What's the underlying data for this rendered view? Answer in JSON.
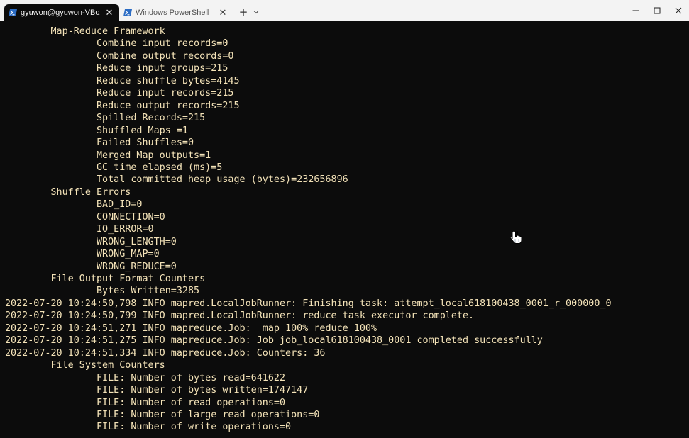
{
  "tabs": [
    {
      "label": "gyuwon@gyuwon-VBox: ~/v",
      "active": true,
      "icon": "powershell-icon"
    },
    {
      "label": "Windows PowerShell",
      "active": false,
      "icon": "powershell-icon"
    }
  ],
  "controls": {
    "new_tab": "+",
    "close_glyph": "✕"
  },
  "colors": {
    "terminal_bg": "#0c0c0c",
    "terminal_text": "#f4e3b8",
    "titlebar_bg": "#f3f3f3",
    "powershell_blue": "#2b6cc4"
  },
  "terminal": {
    "lines": [
      "        Map-Reduce Framework",
      "                Combine input records=0",
      "                Combine output records=0",
      "                Reduce input groups=215",
      "                Reduce shuffle bytes=4145",
      "                Reduce input records=215",
      "                Reduce output records=215",
      "                Spilled Records=215",
      "                Shuffled Maps =1",
      "                Failed Shuffles=0",
      "                Merged Map outputs=1",
      "                GC time elapsed (ms)=5",
      "                Total committed heap usage (bytes)=232656896",
      "        Shuffle Errors",
      "                BAD_ID=0",
      "                CONNECTION=0",
      "                IO_ERROR=0",
      "                WRONG_LENGTH=0",
      "                WRONG_MAP=0",
      "                WRONG_REDUCE=0",
      "        File Output Format Counters",
      "                Bytes Written=3285",
      "2022-07-20 10:24:50,798 INFO mapred.LocalJobRunner: Finishing task: attempt_local618100438_0001_r_000000_0",
      "2022-07-20 10:24:50,799 INFO mapred.LocalJobRunner: reduce task executor complete.",
      "2022-07-20 10:24:51,271 INFO mapreduce.Job:  map 100% reduce 100%",
      "2022-07-20 10:24:51,275 INFO mapreduce.Job: Job job_local618100438_0001 completed successfully",
      "2022-07-20 10:24:51,334 INFO mapreduce.Job: Counters: 36",
      "        File System Counters",
      "                FILE: Number of bytes read=641622",
      "                FILE: Number of bytes written=1747147",
      "                FILE: Number of read operations=0",
      "                FILE: Number of large read operations=0",
      "                FILE: Number of write operations=0"
    ]
  }
}
